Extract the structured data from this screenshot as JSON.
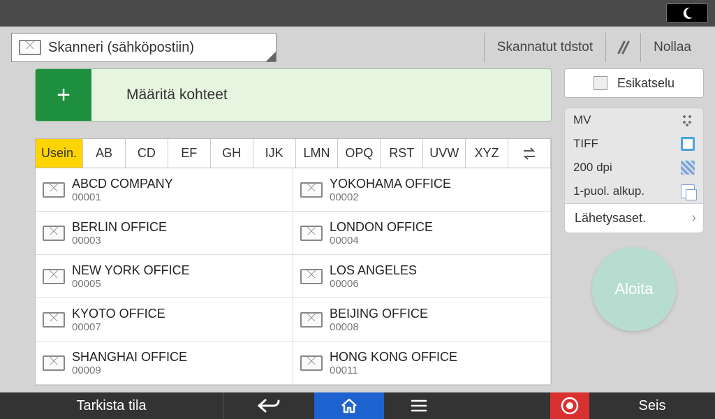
{
  "header": {
    "mode_label": "Skanneri (sähköpostiin)",
    "scanned_files": "Skannatut tdstot",
    "reset": "Nollaa"
  },
  "destinations_button": {
    "plus": "+",
    "label": "Määritä kohteet"
  },
  "alpha_tabs": {
    "freq": "Usein.",
    "groups": [
      "AB",
      "CD",
      "EF",
      "GH",
      "IJK",
      "LMN",
      "OPQ",
      "RST",
      "UVW",
      "XYZ"
    ]
  },
  "addresses": [
    {
      "name": "ABCD COMPANY",
      "num": "00001"
    },
    {
      "name": "YOKOHAMA OFFICE",
      "num": "00002"
    },
    {
      "name": "BERLIN OFFICE",
      "num": "00003"
    },
    {
      "name": "LONDON OFFICE",
      "num": "00004"
    },
    {
      "name": "NEW YORK OFFICE",
      "num": "00005"
    },
    {
      "name": "LOS ANGELES",
      "num": "00006"
    },
    {
      "name": "KYOTO OFFICE",
      "num": "00007"
    },
    {
      "name": "BEIJING OFFICE",
      "num": "00008"
    },
    {
      "name": "SHANGHAI  OFFICE",
      "num": "00009"
    },
    {
      "name": "HONG KONG OFFICE",
      "num": "00011"
    }
  ],
  "right_panel": {
    "preview": "Esikatselu",
    "settings": {
      "color": "MV",
      "format": "TIFF",
      "resolution": "200 dpi",
      "sides": "1-puol. alkup."
    },
    "send_settings": "Lähetysaset.",
    "start": "Aloita"
  },
  "bottom_bar": {
    "status": "Tarkista tila",
    "stop": "Seis"
  }
}
